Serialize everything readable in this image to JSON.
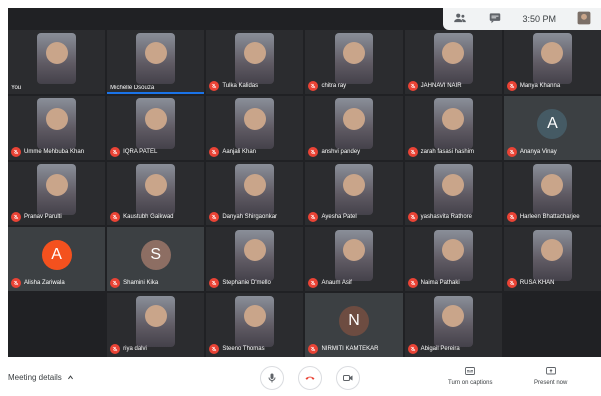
{
  "topbar": {
    "people_icon": "people-icon",
    "chat_icon": "chat-icon",
    "time": "3:50 PM",
    "avatar_icon": "self-avatar"
  },
  "tiles": [
    {
      "name": "You",
      "type": "camera",
      "mic": false
    },
    {
      "name": "Michelle Dsouza",
      "type": "camera",
      "mic": false,
      "active": true
    },
    {
      "name": "Tulka Kalidas",
      "type": "camera",
      "mic": true
    },
    {
      "name": "chitra ray",
      "type": "camera",
      "mic": true
    },
    {
      "name": "JAHNAVI NAIR",
      "type": "camera",
      "mic": true
    },
    {
      "name": "Manya Khanna",
      "type": "camera",
      "mic": true
    },
    {
      "name": "Umme Mehbuba Khan",
      "type": "camera",
      "mic": true
    },
    {
      "name": "IQRA PATEL",
      "type": "camera",
      "mic": true
    },
    {
      "name": "Aanjali Khan",
      "type": "camera",
      "mic": true
    },
    {
      "name": "anshvi pandey",
      "type": "camera",
      "mic": true
    },
    {
      "name": "zarah fasasi hashim",
      "type": "camera",
      "mic": true
    },
    {
      "name": "Ananya Vinay",
      "type": "avatar",
      "letter": "A",
      "color": "#455a64",
      "mic": true
    },
    {
      "name": "Pranav Parulti",
      "type": "camera",
      "mic": true
    },
    {
      "name": "Kaustubh Gaikwad",
      "type": "camera",
      "mic": true
    },
    {
      "name": "Danyah Shirgaonkar",
      "type": "camera",
      "mic": true
    },
    {
      "name": "Ayesha Patel",
      "type": "camera",
      "mic": true
    },
    {
      "name": "yashasvita Rathore",
      "type": "camera",
      "mic": true
    },
    {
      "name": "Harleen Bhattacharjee",
      "type": "camera",
      "mic": true
    },
    {
      "name": "Alisha Zariwala",
      "type": "avatar",
      "letter": "A",
      "color": "#f4511e",
      "mic": true
    },
    {
      "name": "Shamini Kika",
      "type": "avatar",
      "letter": "S",
      "color": "#8d6e63",
      "mic": true
    },
    {
      "name": "Stephanie D'mello",
      "type": "camera",
      "mic": true
    },
    {
      "name": "Anaum Asif",
      "type": "camera",
      "mic": true
    },
    {
      "name": "Naima Pathaki",
      "type": "camera",
      "mic": true
    },
    {
      "name": "RUSA KHAN",
      "type": "camera",
      "mic": true
    },
    {
      "name": "",
      "type": "empty"
    },
    {
      "name": "riya dalvi",
      "type": "camera",
      "mic": true
    },
    {
      "name": "Steeno Thomas",
      "type": "camera",
      "mic": true
    },
    {
      "name": "NIRMITI KAMTEKAR",
      "type": "avatar",
      "letter": "N",
      "color": "#6d4c41",
      "mic": true
    },
    {
      "name": "Abigail Pereira",
      "type": "camera",
      "mic": true
    },
    {
      "name": "",
      "type": "empty"
    }
  ],
  "bottombar": {
    "meeting_details": "Meeting details",
    "captions_label": "Turn on captions",
    "present_label": "Present now"
  }
}
